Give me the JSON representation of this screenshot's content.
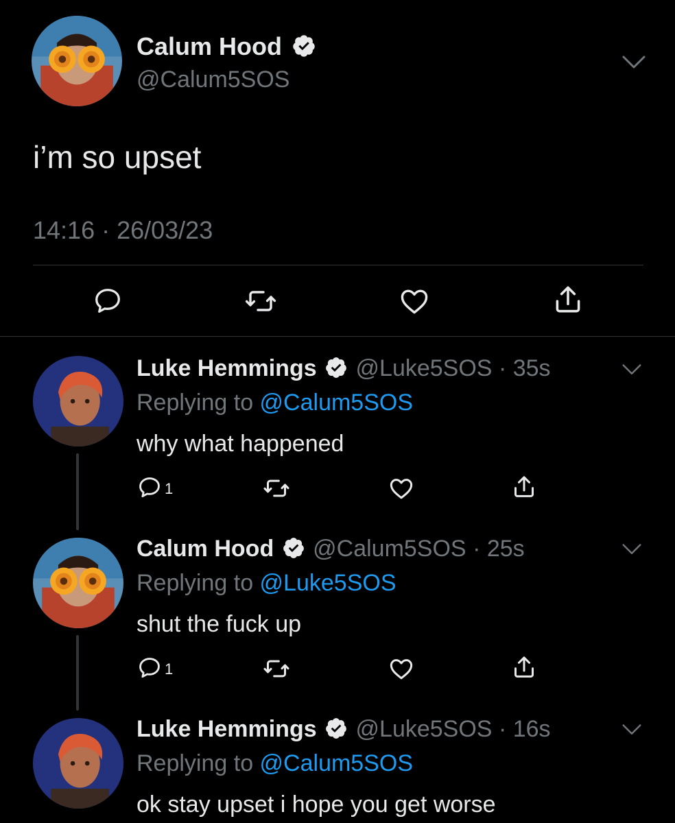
{
  "main_tweet": {
    "author_name": "Calum Hood",
    "handle": "@Calum5SOS",
    "text": "i’m so upset",
    "timestamp": "14:16 · 26/03/23",
    "actions": [
      "reply-icon",
      "retweet-icon",
      "like-icon",
      "share-icon"
    ]
  },
  "replies": [
    {
      "author_name": "Luke Hemmings",
      "handle": "@Luke5SOS",
      "sep": "·",
      "time": "35s",
      "replying_prefix": "Replying to ",
      "replying_to": "@Calum5SOS",
      "text": "why what happened",
      "reply_count": "1"
    },
    {
      "author_name": "Calum Hood",
      "handle": "@Calum5SOS",
      "sep": "·",
      "time": "25s",
      "replying_prefix": "Replying to ",
      "replying_to": "@Luke5SOS",
      "text": "shut the fuck up",
      "reply_count": "1"
    },
    {
      "author_name": "Luke Hemmings",
      "handle": "@Luke5SOS",
      "sep": "·",
      "time": "16s",
      "replying_prefix": "Replying to ",
      "replying_to": "@Calum5SOS",
      "text": "ok stay upset i hope you get worse"
    }
  ],
  "colors": {
    "background": "#000000",
    "text": "#e7e9ea",
    "muted": "#71767b",
    "link": "#1d9bf0"
  }
}
